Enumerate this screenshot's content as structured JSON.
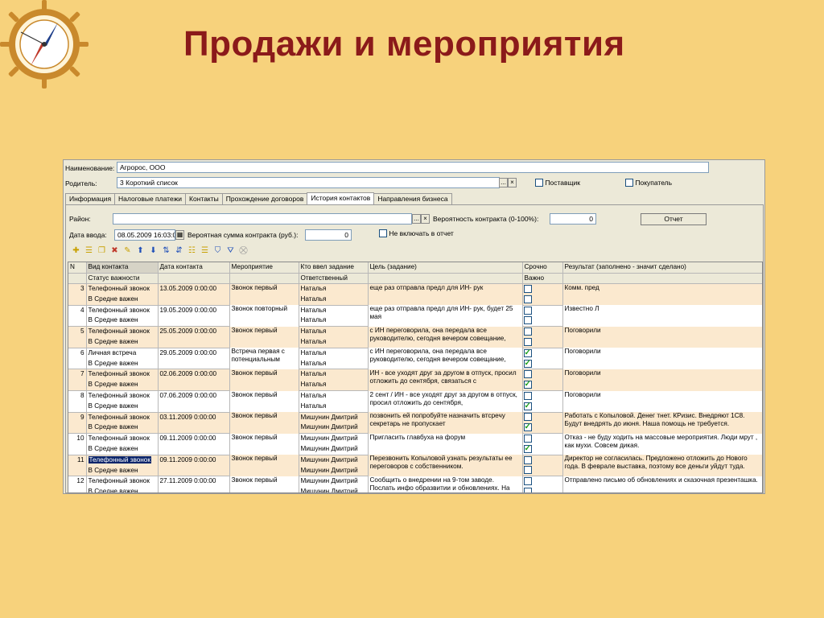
{
  "slide": {
    "title": "Продажи и мероприятия"
  },
  "form": {
    "name_label": "Наименование:",
    "name_value": "Агророс, ООО",
    "parent_label": "Родитель:",
    "parent_value": "3 Короткий список",
    "supplier_label": "Поставщик",
    "buyer_label": "Покупатель",
    "tabs": [
      {
        "label": "Информация"
      },
      {
        "label": "Налоговые платежи"
      },
      {
        "label": "Контакты"
      },
      {
        "label": "Прохождение договоров"
      },
      {
        "label": "История контактов"
      },
      {
        "label": "Направления бизнеса"
      }
    ],
    "region_label": "Район:",
    "region_value": "",
    "probability_label": "Вероятность контракта (0-100%):",
    "probability_value": "0",
    "report_button": "Отчет",
    "date_label": "Дата ввода:",
    "date_value": "08.05.2009 16:03:0",
    "amount_label": "Вероятная сумма контракта (руб.):",
    "amount_value": "0",
    "exclude_label": "Не включать в отчет",
    "dots": "...",
    "clear": "×"
  },
  "toolbar_icons": [
    "add-row-icon",
    "add-group-icon",
    "copy-row-icon",
    "delete-row-icon",
    "edit-row-icon",
    "move-up-icon",
    "move-down-icon",
    "sort-asc-icon",
    "sort-desc-icon",
    "hierarchy-icon",
    "list-icon",
    "filter-icon",
    "filter-set-icon",
    "filter-off-icon"
  ],
  "grid": {
    "headers": {
      "n": "N",
      "type": "Вид контакта",
      "status": "Статус важности",
      "date": "Дата контакта",
      "event": "Мероприятие",
      "who": "Кто ввел задание",
      "resp": "Ответственный",
      "goal": "Цель (задание)",
      "urgent": "Срочно",
      "important": "Важно",
      "result": "Результат (заполнено - значит сделано)"
    },
    "rows": [
      {
        "n": "3",
        "type": "Телефонный звонок",
        "status": "В Средне важен",
        "date": "13.05.2009 0:00:00",
        "event": "Звонок первый",
        "who": "Наталья",
        "resp": "Наталья",
        "goal": "еще раз отправла предл для ИН- рук",
        "urgent": false,
        "important": false,
        "result": "Комм. пред"
      },
      {
        "n": "4",
        "type": "Телефонный звонок",
        "status": "В Средне важен",
        "date": "19.05.2009 0:00:00",
        "event": "Звонок повторный",
        "who": "Наталья",
        "resp": "Наталья",
        "goal": "еще раз отправла предл для ИН- рук, будет 25 мая",
        "urgent": false,
        "important": false,
        "result": "Известно Л"
      },
      {
        "n": "5",
        "type": "Телефонный звонок",
        "status": "В Средне важен",
        "date": "25.05.2009 0:00:00",
        "event": "Звонок первый",
        "who": "Наталья",
        "resp": "Наталья",
        "goal": "с ИН переговорила, она передала все руководителю, сегодня вечером совещание,",
        "urgent": false,
        "important": false,
        "result": "Поговорили"
      },
      {
        "n": "6",
        "type": "Личная встреча",
        "status": "В Средне важен",
        "date": "29.05.2009 0:00:00",
        "event": "Встреча первая с потенциальным",
        "who": "Наталья",
        "resp": "Наталья",
        "goal": "с ИН переговорила, она передала все руководителю, сегодня вечером совещание,",
        "urgent": true,
        "important": true,
        "result": "Поговорили"
      },
      {
        "n": "7",
        "type": "Телефонный звонок",
        "status": "В Средне важен",
        "date": "02.06.2009 0:00:00",
        "event": "Звонок первый",
        "who": "Наталья",
        "resp": "Наталья",
        "goal": "ИН - все уходят друг за другом в отпуск, просил отложить до сентября, связаться с",
        "urgent": false,
        "important": true,
        "result": "Поговорили"
      },
      {
        "n": "8",
        "type": "Телефонный звонок",
        "status": "В Средне важен",
        "date": "07.06.2009 0:00:00",
        "event": "Звонок первый",
        "who": "Наталья",
        "resp": "Наталья",
        "goal": "2 сент / ИН - все уходят друг за другом в отпуск, просил отложить до сентября,",
        "urgent": false,
        "important": true,
        "result": "Поговорили"
      },
      {
        "n": "9",
        "type": "Телефонный звонок",
        "status": "В Средне важен",
        "date": "03.11.2009 0:00:00",
        "event": "Звонок первый",
        "who": "Мишунин Дмитрий",
        "resp": "Мишунин Дмитрий",
        "goal": "позвонить ей попробуйте назначить втсречу секретарь не пропускает",
        "urgent": false,
        "important": true,
        "result": "Работать с Копыловой. Денег тнет. КРизис. Внедряют 1С8. Будут внедрять до июня. Наша помощь не требуется."
      },
      {
        "n": "10",
        "type": "Телефонный звонок",
        "status": "В Средне важен",
        "date": "09.11.2009 0:00:00",
        "event": "Звонок первый",
        "who": "Мишунин Дмитрий",
        "resp": "Мишунин Дмитрий",
        "goal": "Пригласить главбуха на форум",
        "urgent": false,
        "important": true,
        "result": "Отказ - не буду ходить на массовые мероприятия. Люди мрут , как мухи. Совсем дикая."
      },
      {
        "n": "11",
        "type": "Телефонный звонок",
        "status": "В Средне важен",
        "date": "09.11.2009 0:00:00",
        "event": "Звонок первый",
        "who": "Мишунин Дмитрий",
        "resp": "Мишунин Дмитрий",
        "goal": "Перезвонить Копыловой узнать результаты ее переговоров с собственником.",
        "urgent": false,
        "important": false,
        "result": "Директор не согласилась. Предложено отложить до Нового года. В феврале выставка, поэтому все деньги уйдут туда."
      },
      {
        "n": "12",
        "type": "Телефонный звонок",
        "status": "В Средне важен",
        "date": "27.11.2009 0:00:00",
        "event": "Звонок первый",
        "who": "Мишунин Дмитрий",
        "resp": "Мишунин Дмитрий",
        "goal": "Сообщить о внедрении на 9-том заводе. Послать инфо образвитии и обновлениях. На",
        "urgent": false,
        "important": false,
        "result": "Отправлено письмо об обновлениях и сказочная презенташка."
      }
    ]
  },
  "colors": {
    "title": "#8b1a1a",
    "background": "#f7d27c",
    "selection": "#0a246a",
    "row_tint": "#fbe9cf"
  }
}
